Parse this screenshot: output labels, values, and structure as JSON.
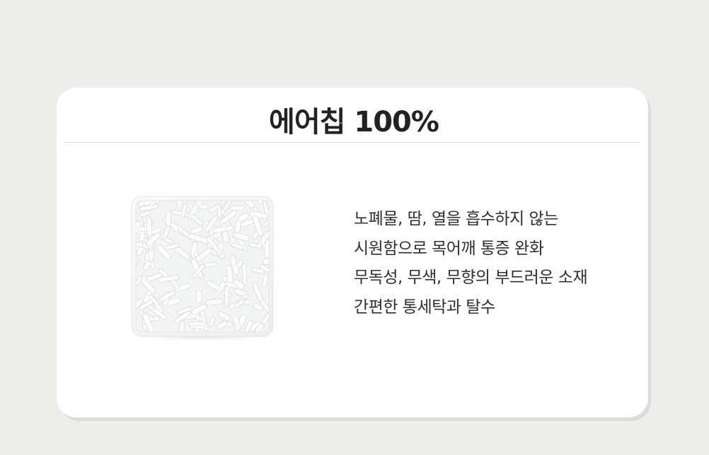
{
  "title": "에어칩 100%",
  "features": [
    "노폐물, 땀, 열을 흡수하지 않는",
    "시원함으로 목어깨 통증 완화",
    "무독성, 무색, 무향의 부드러운 소재",
    "간편한 통세탁과 탈수"
  ],
  "colors": {
    "background": "#ededec",
    "card": "#ffffff",
    "text": "#2f2f2f"
  }
}
